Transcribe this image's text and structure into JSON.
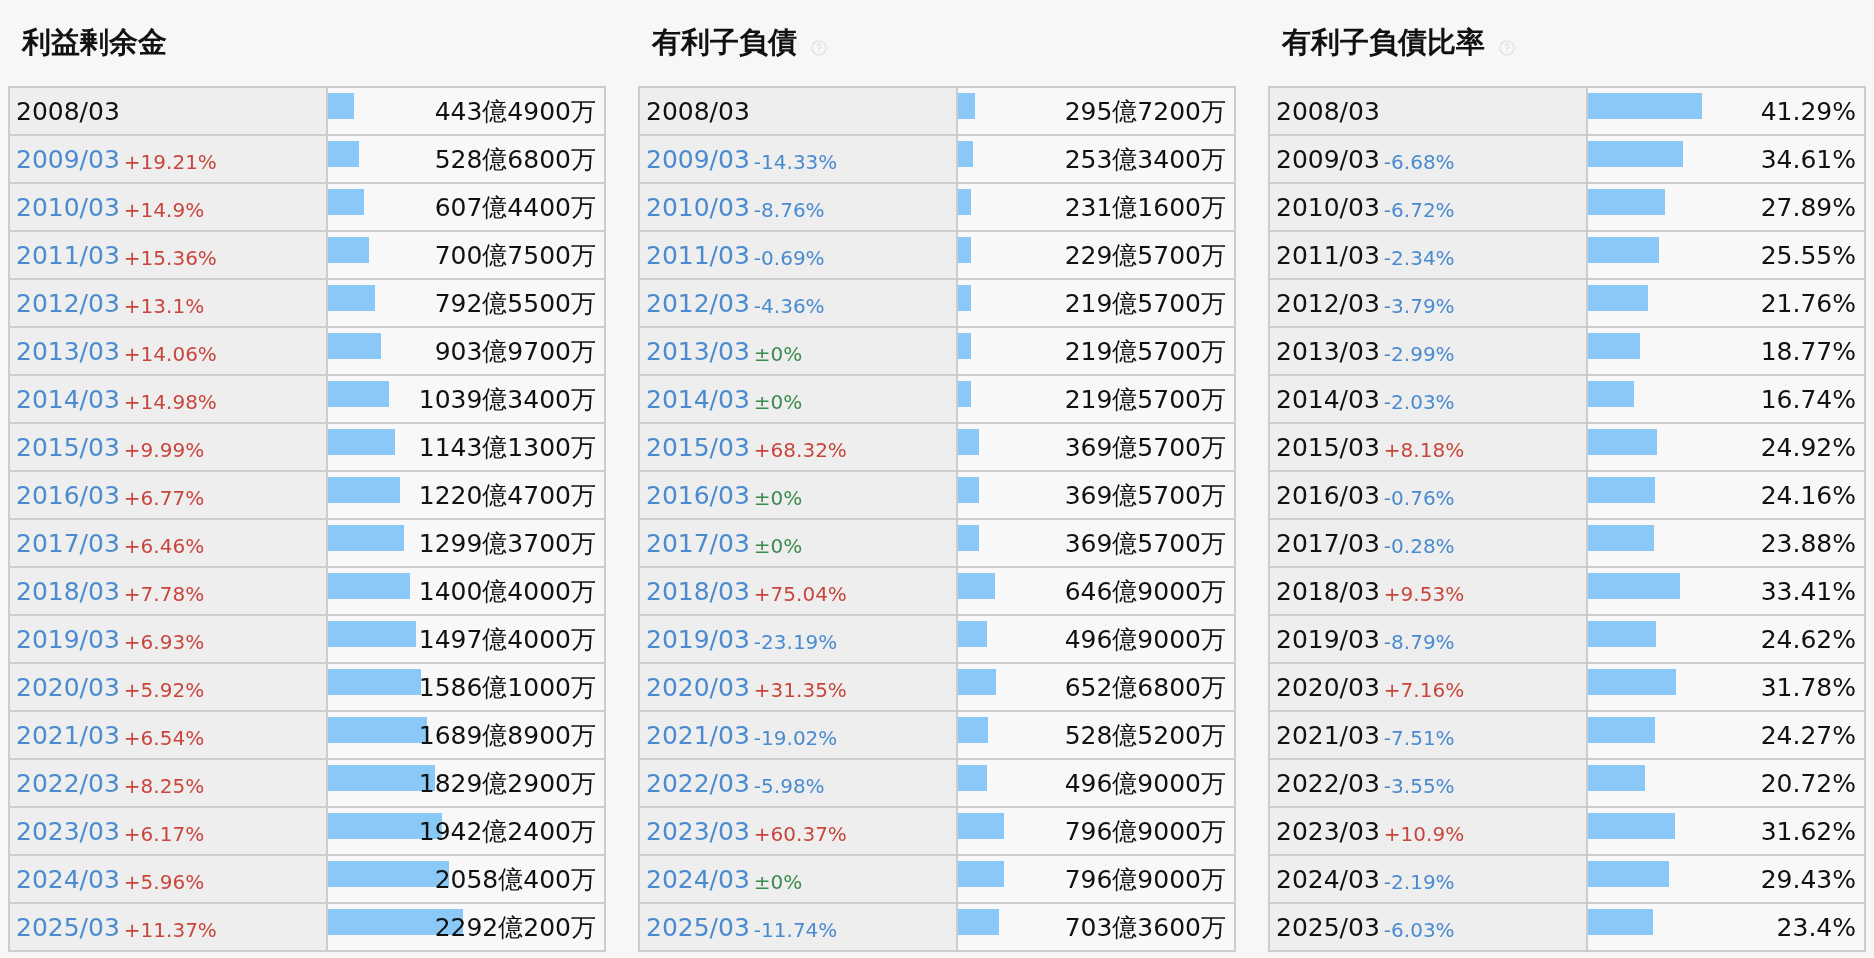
{
  "panels": [
    {
      "title": "利益剰余金",
      "rows": [
        {
          "period": "2008/03",
          "linked": false,
          "level": 0.094,
          "value": "443億4900万"
        },
        {
          "period": "2009/03",
          "linked": true,
          "change": "+19.21%",
          "color": "#c9463d",
          "level": 0.112,
          "value": "528億6800万"
        },
        {
          "period": "2010/03",
          "linked": true,
          "change": "+14.9%",
          "color": "#c9463d",
          "level": 0.129,
          "value": "607億4400万"
        },
        {
          "period": "2011/03",
          "linked": true,
          "change": "+15.36%",
          "color": "#c9463d",
          "level": 0.149,
          "value": "700億7500万"
        },
        {
          "period": "2012/03",
          "linked": true,
          "change": "+13.1%",
          "color": "#c9463d",
          "level": 0.169,
          "value": "792億5500万"
        },
        {
          "period": "2013/03",
          "linked": true,
          "change": "+14.06%",
          "color": "#c9463d",
          "level": 0.192,
          "value": "903億9700万"
        },
        {
          "period": "2014/03",
          "linked": true,
          "change": "+14.98%",
          "color": "#c9463d",
          "level": 0.221,
          "value": "1039億3400万"
        },
        {
          "period": "2015/03",
          "linked": true,
          "change": "+9.99%",
          "color": "#c9463d",
          "level": 0.243,
          "value": "1143億1300万"
        },
        {
          "period": "2016/03",
          "linked": true,
          "change": "+6.77%",
          "color": "#c9463d",
          "level": 0.26,
          "value": "1220億4700万"
        },
        {
          "period": "2017/03",
          "linked": true,
          "change": "+6.46%",
          "color": "#c9463d",
          "level": 0.276,
          "value": "1299億3700万"
        },
        {
          "period": "2018/03",
          "linked": true,
          "change": "+7.78%",
          "color": "#c9463d",
          "level": 0.298,
          "value": "1400億4000万"
        },
        {
          "period": "2019/03",
          "linked": true,
          "change": "+6.93%",
          "color": "#c9463d",
          "level": 0.319,
          "value": "1497億4000万"
        },
        {
          "period": "2020/03",
          "linked": true,
          "change": "+5.92%",
          "color": "#c9463d",
          "level": 0.337,
          "value": "1586億1000万"
        },
        {
          "period": "2021/03",
          "linked": true,
          "change": "+6.54%",
          "color": "#c9463d",
          "level": 0.36,
          "value": "1689億8900万"
        },
        {
          "period": "2022/03",
          "linked": true,
          "change": "+8.25%",
          "color": "#c9463d",
          "level": 0.389,
          "value": "1829億2900万"
        },
        {
          "period": "2023/03",
          "linked": true,
          "change": "+6.17%",
          "color": "#c9463d",
          "level": 0.413,
          "value": "1942億2400万"
        },
        {
          "period": "2024/03",
          "linked": true,
          "change": "+5.96%",
          "color": "#c9463d",
          "level": 0.438,
          "value": "2058億400万"
        },
        {
          "period": "2025/03",
          "linked": true,
          "change": "+11.37%",
          "color": "#c9463d",
          "level": 0.488,
          "value": "2292億200万"
        }
      ]
    },
    {
      "title": "有利子負債",
      "help": true,
      "rows": [
        {
          "period": "2008/03",
          "linked": false,
          "level": 0.062,
          "value": "295億7200万"
        },
        {
          "period": "2009/03",
          "linked": true,
          "change": "-14.33%",
          "color": "#4a8bd0",
          "level": 0.053,
          "value": "253億3400万"
        },
        {
          "period": "2010/03",
          "linked": true,
          "change": "-8.76%",
          "color": "#4a8bd0",
          "level": 0.048,
          "value": "231億1600万"
        },
        {
          "period": "2011/03",
          "linked": true,
          "change": "-0.69%",
          "color": "#4a8bd0",
          "level": 0.048,
          "value": "229億5700万"
        },
        {
          "period": "2012/03",
          "linked": true,
          "change": "-4.36%",
          "color": "#4a8bd0",
          "level": 0.046,
          "value": "219億5700万"
        },
        {
          "period": "2013/03",
          "linked": true,
          "change": "±0%",
          "color": "#3d8a4e",
          "level": 0.046,
          "value": "219億5700万"
        },
        {
          "period": "2014/03",
          "linked": true,
          "change": "±0%",
          "color": "#3d8a4e",
          "level": 0.046,
          "value": "219億5700万"
        },
        {
          "period": "2015/03",
          "linked": true,
          "change": "+68.32%",
          "color": "#c9463d",
          "level": 0.077,
          "value": "369億5700万"
        },
        {
          "period": "2016/03",
          "linked": true,
          "change": "±0%",
          "color": "#3d8a4e",
          "level": 0.077,
          "value": "369億5700万"
        },
        {
          "period": "2017/03",
          "linked": true,
          "change": "±0%",
          "color": "#3d8a4e",
          "level": 0.077,
          "value": "369億5700万"
        },
        {
          "period": "2018/03",
          "linked": true,
          "change": "+75.04%",
          "color": "#c9463d",
          "level": 0.135,
          "value": "646億9000万"
        },
        {
          "period": "2019/03",
          "linked": true,
          "change": "-23.19%",
          "color": "#4a8bd0",
          "level": 0.104,
          "value": "496億9000万"
        },
        {
          "period": "2020/03",
          "linked": true,
          "change": "+31.35%",
          "color": "#c9463d",
          "level": 0.136,
          "value": "652億6800万"
        },
        {
          "period": "2021/03",
          "linked": true,
          "change": "-19.02%",
          "color": "#4a8bd0",
          "level": 0.11,
          "value": "528億5200万"
        },
        {
          "period": "2022/03",
          "linked": true,
          "change": "-5.98%",
          "color": "#4a8bd0",
          "level": 0.104,
          "value": "496億9000万"
        },
        {
          "period": "2023/03",
          "linked": true,
          "change": "+60.37%",
          "color": "#c9463d",
          "level": 0.166,
          "value": "796億9000万"
        },
        {
          "period": "2024/03",
          "linked": true,
          "change": "±0%",
          "color": "#3d8a4e",
          "level": 0.166,
          "value": "796億9000万"
        },
        {
          "period": "2025/03",
          "linked": true,
          "change": "-11.74%",
          "color": "#4a8bd0",
          "level": 0.147,
          "value": "703億3600万"
        }
      ]
    },
    {
      "title": "有利子負債比率",
      "help": true,
      "rows": [
        {
          "period": "2008/03",
          "linked": false,
          "level": 0.413,
          "value": "41.29%"
        },
        {
          "period": "2009/03",
          "linked": false,
          "change": "-6.68%",
          "color": "#4a8bd0",
          "level": 0.346,
          "value": "34.61%"
        },
        {
          "period": "2010/03",
          "linked": false,
          "change": "-6.72%",
          "color": "#4a8bd0",
          "level": 0.279,
          "value": "27.89%"
        },
        {
          "period": "2011/03",
          "linked": false,
          "change": "-2.34%",
          "color": "#4a8bd0",
          "level": 0.256,
          "value": "25.55%"
        },
        {
          "period": "2012/03",
          "linked": false,
          "change": "-3.79%",
          "color": "#4a8bd0",
          "level": 0.218,
          "value": "21.76%"
        },
        {
          "period": "2013/03",
          "linked": false,
          "change": "-2.99%",
          "color": "#4a8bd0",
          "level": 0.188,
          "value": "18.77%"
        },
        {
          "period": "2014/03",
          "linked": false,
          "change": "-2.03%",
          "color": "#4a8bd0",
          "level": 0.167,
          "value": "16.74%"
        },
        {
          "period": "2015/03",
          "linked": false,
          "change": "+8.18%",
          "color": "#c9463d",
          "level": 0.249,
          "value": "24.92%"
        },
        {
          "period": "2016/03",
          "linked": false,
          "change": "-0.76%",
          "color": "#4a8bd0",
          "level": 0.242,
          "value": "24.16%"
        },
        {
          "period": "2017/03",
          "linked": false,
          "change": "-0.28%",
          "color": "#4a8bd0",
          "level": 0.239,
          "value": "23.88%"
        },
        {
          "period": "2018/03",
          "linked": false,
          "change": "+9.53%",
          "color": "#c9463d",
          "level": 0.334,
          "value": "33.41%"
        },
        {
          "period": "2019/03",
          "linked": false,
          "change": "-8.79%",
          "color": "#4a8bd0",
          "level": 0.246,
          "value": "24.62%"
        },
        {
          "period": "2020/03",
          "linked": false,
          "change": "+7.16%",
          "color": "#c9463d",
          "level": 0.318,
          "value": "31.78%"
        },
        {
          "period": "2021/03",
          "linked": false,
          "change": "-7.51%",
          "color": "#4a8bd0",
          "level": 0.243,
          "value": "24.27%"
        },
        {
          "period": "2022/03",
          "linked": false,
          "change": "-3.55%",
          "color": "#4a8bd0",
          "level": 0.207,
          "value": "20.72%"
        },
        {
          "period": "2023/03",
          "linked": false,
          "change": "+10.9%",
          "color": "#c9463d",
          "level": 0.316,
          "value": "31.62%"
        },
        {
          "period": "2024/03",
          "linked": false,
          "change": "-2.19%",
          "color": "#4a8bd0",
          "level": 0.294,
          "value": "29.43%"
        },
        {
          "period": "2025/03",
          "linked": false,
          "change": "-6.03%",
          "color": "#4a8bd0",
          "level": 0.234,
          "value": "23.4%"
        }
      ]
    }
  ]
}
